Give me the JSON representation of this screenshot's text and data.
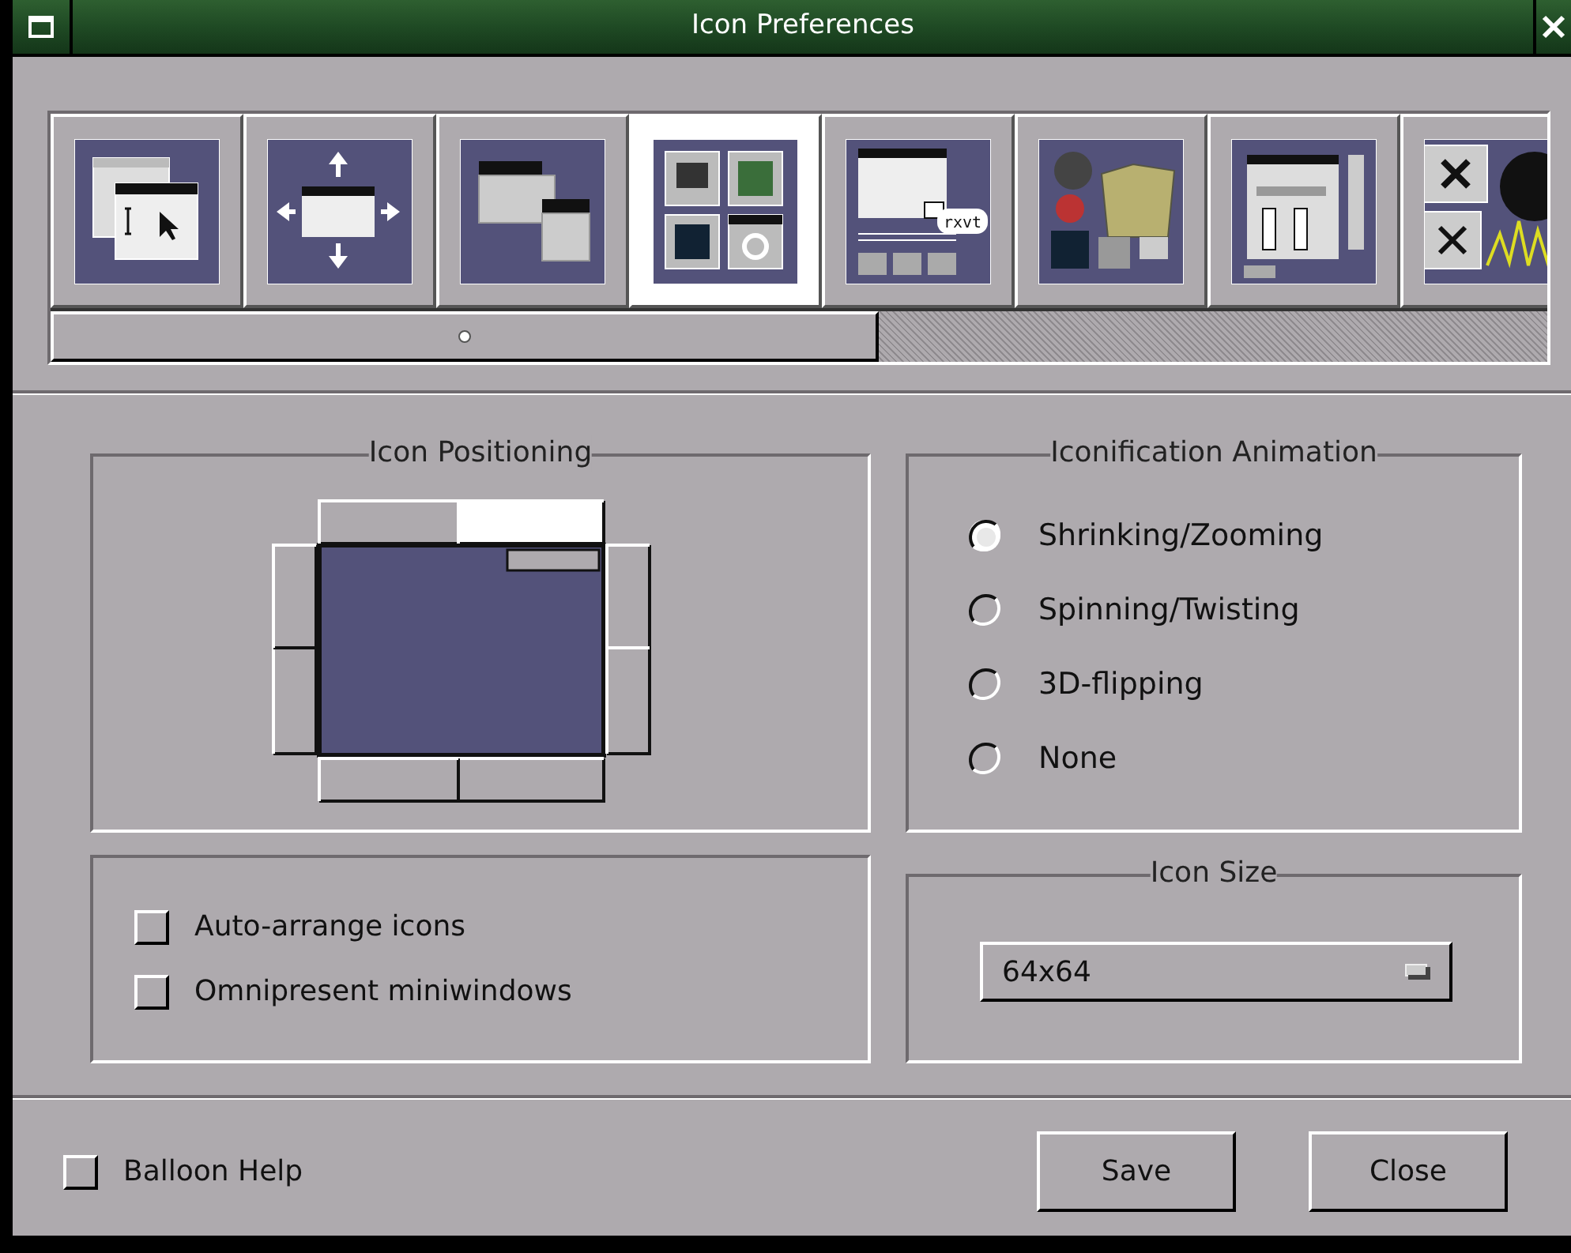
{
  "window": {
    "title": "Icon Preferences"
  },
  "sections": [
    {
      "kind": "focus",
      "selected": false
    },
    {
      "kind": "placement",
      "selected": false
    },
    {
      "kind": "menu",
      "selected": false
    },
    {
      "kind": "icons",
      "selected": true
    },
    {
      "kind": "misc",
      "selected": false,
      "bubble": "rxvt"
    },
    {
      "kind": "appearance",
      "selected": false
    },
    {
      "kind": "workspace",
      "selected": false
    },
    {
      "kind": "mouse",
      "selected": false
    }
  ],
  "icon_positioning": {
    "title": "Icon Positioning",
    "positions": [
      {
        "selected": false
      },
      {
        "selected": true
      },
      {
        "selected": false
      },
      {
        "selected": false
      },
      {
        "selected": false
      },
      {
        "selected": false
      },
      {
        "selected": false
      },
      {
        "selected": false
      }
    ]
  },
  "options": [
    {
      "label": "Auto-arrange icons",
      "checked": false
    },
    {
      "label": "Omnipresent miniwindows",
      "checked": false
    }
  ],
  "iconification_animation": {
    "title": "Iconification Animation",
    "options": [
      {
        "label": "Shrinking/Zooming",
        "selected": true
      },
      {
        "label": "Spinning/Twisting",
        "selected": false
      },
      {
        "label": "3D-flipping",
        "selected": false
      },
      {
        "label": "None",
        "selected": false
      }
    ]
  },
  "icon_size": {
    "title": "Icon Size",
    "value": "64x64"
  },
  "balloon_help": {
    "label": "Balloon Help",
    "checked": false
  },
  "buttons": [
    "Save",
    "Close"
  ]
}
